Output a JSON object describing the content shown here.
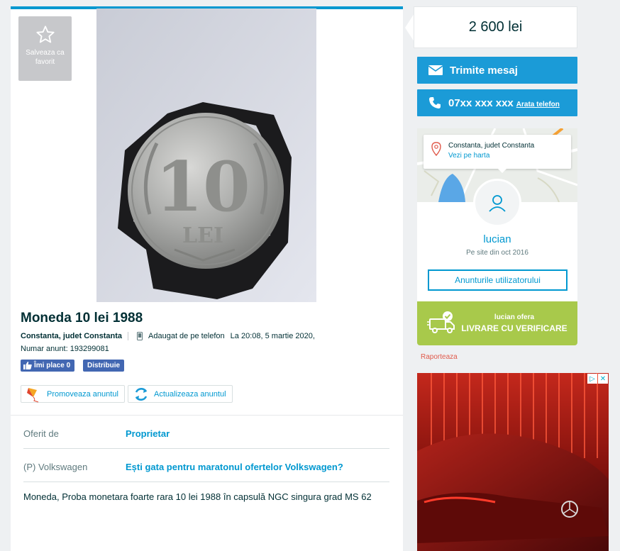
{
  "listing": {
    "favorite_label": "Salveaza ca favorit",
    "title": "Moneda 10 lei 1988",
    "location": "Constanta, judet Constanta",
    "added_via": "Adaugat de pe telefon",
    "added_at": "La 20:08, 5 martie 2020,",
    "ad_number": "Numar anunt: 193299081",
    "fb_like": "Îmi place 0",
    "fb_share": "Distribuie",
    "promote": "Promoveaza anuntul",
    "refresh": "Actualizeaza anuntul",
    "details": [
      {
        "key": "Oferit de",
        "value": "Proprietar"
      },
      {
        "key": "(P) Volkswagen",
        "value": "Ești gata pentru maratonul ofertelor Volkswagen?"
      }
    ],
    "description": "Moneda, Proba monetara foarte rara 10 lei 1988 în capsulă NGC singura grad MS 62",
    "coin_text": {
      "value": "10",
      "unit": "LEI"
    }
  },
  "sidebar": {
    "price": "2 600 lei",
    "message_button": "Trimite mesaj",
    "phone_number": "07xx xxx xxx",
    "show_phone": "Arata telefon",
    "map_location": "Constanta, judet Constanta",
    "map_link": "Vezi pe harta",
    "user_name": "lucian",
    "member_since": "Pe site din oct 2016",
    "user_ads_button": "Anunturile utilizatorului",
    "delivery_offer": "lucian ofera",
    "delivery_title": "LIVRARE CU VERIFICARE",
    "report": "Raporteaza"
  },
  "colors": {
    "accent": "#0098d0",
    "button_blue": "#1b9bd7",
    "delivery_green": "#a8c94b",
    "report_red": "#e05a4b",
    "facebook": "#4267b2"
  },
  "icons": [
    "star-icon",
    "phone-icon",
    "thumbs-up-icon",
    "kite-icon",
    "refresh-icon",
    "envelope-icon",
    "location-pin-icon",
    "user-icon",
    "delivery-truck-icon"
  ]
}
